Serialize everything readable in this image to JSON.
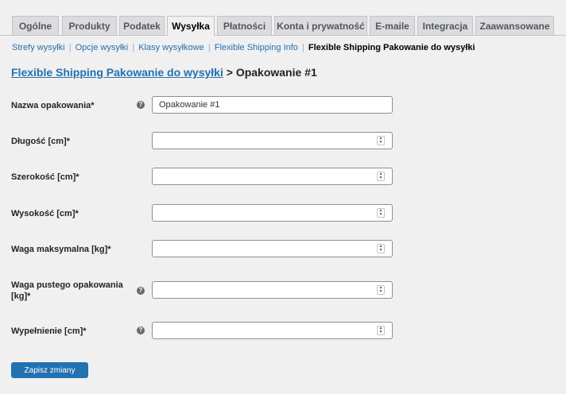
{
  "tabs": [
    {
      "label": "Ogólne"
    },
    {
      "label": "Produkty"
    },
    {
      "label": "Podatek"
    },
    {
      "label": "Wysyłka",
      "active": true
    },
    {
      "label": "Płatności"
    },
    {
      "label": "Konta i prywatność"
    },
    {
      "label": "E-maile"
    },
    {
      "label": "Integracja"
    },
    {
      "label": "Zaawansowane"
    }
  ],
  "subnav": {
    "items": [
      "Strefy wysyłki",
      "Opcje wysyłki",
      "Klasy wysyłkowe",
      "Flexible Shipping Info"
    ],
    "separator": "|",
    "current": "Flexible Shipping Pakowanie do wysyłki"
  },
  "heading": {
    "link": "Flexible Shipping Pakowanie do wysyłki",
    "suffix": " > Opakowanie #1"
  },
  "fields": [
    {
      "label": "Nazwa opakowania*",
      "value": "Opakowanie #1",
      "help": true,
      "type": "text"
    },
    {
      "label": "Długość [cm]*",
      "value": "",
      "help": false,
      "type": "number"
    },
    {
      "label": "Szerokość [cm]*",
      "value": "",
      "help": false,
      "type": "number"
    },
    {
      "label": "Wysokość [cm]*",
      "value": "",
      "help": false,
      "type": "number"
    },
    {
      "label": "Waga maksymalna [kg]*",
      "value": "",
      "help": false,
      "type": "number"
    },
    {
      "label": "Waga pustego opakowania [kg]*",
      "value": "",
      "help": true,
      "type": "number"
    },
    {
      "label": "Wypełnienie [cm]*",
      "value": "",
      "help": true,
      "type": "number"
    }
  ],
  "help_glyph": "?",
  "spinner_up": "▲",
  "spinner_down": "▼",
  "save_label": "Zapisz zmiany",
  "colors": {
    "accent": "#2271b1",
    "background": "#f0f0f1"
  }
}
